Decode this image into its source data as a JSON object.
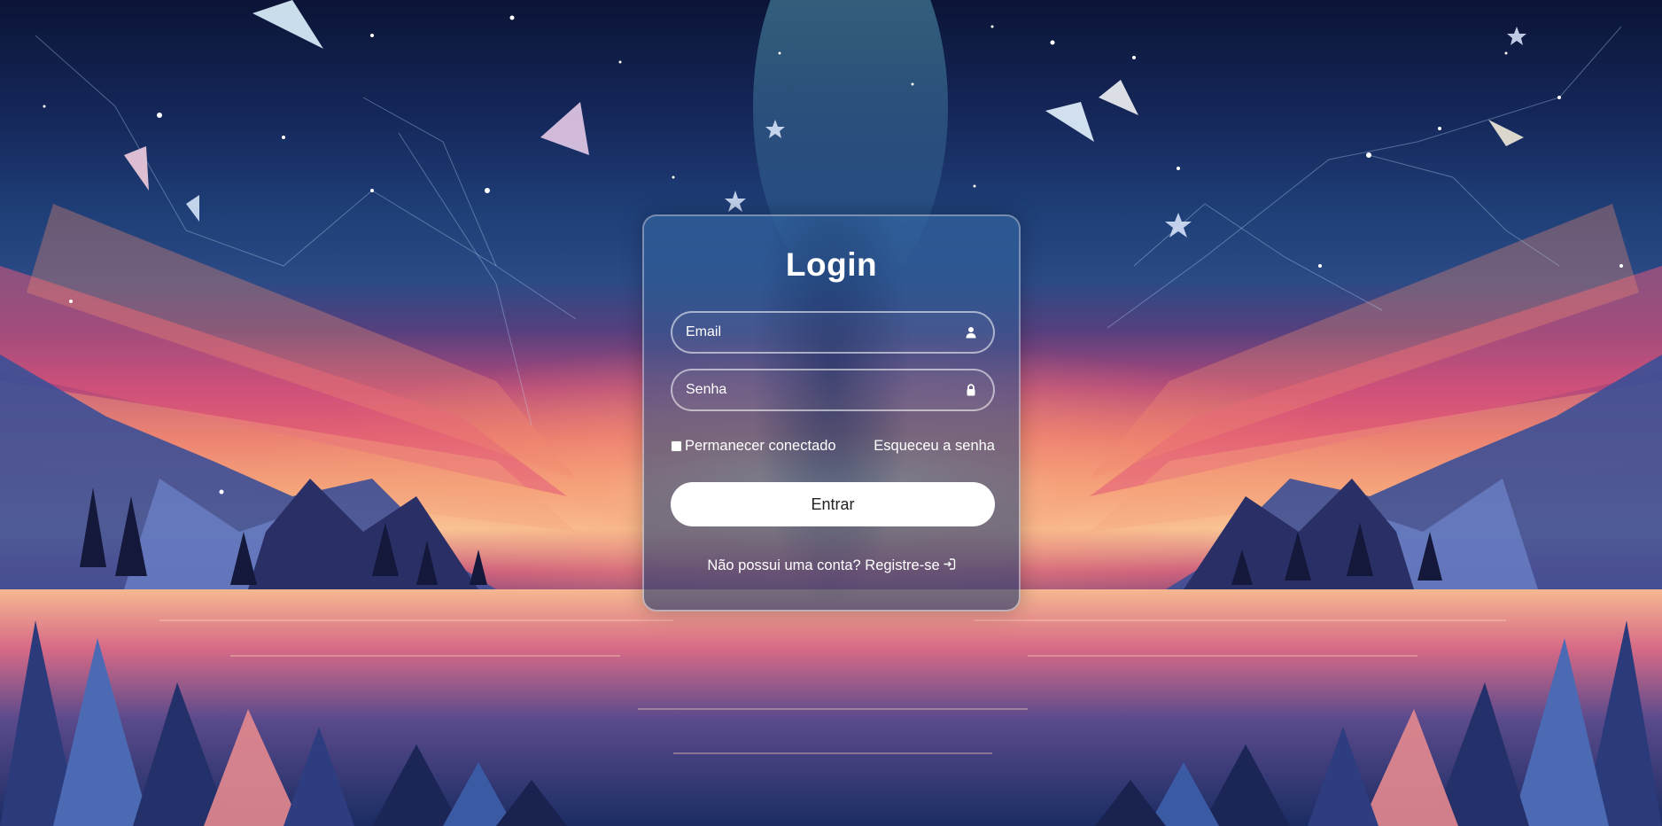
{
  "login": {
    "title": "Login",
    "email": {
      "placeholder": "Email",
      "icon": "user-icon"
    },
    "password": {
      "placeholder": "Senha",
      "icon": "lock-icon"
    },
    "remember_label": "Permanecer conectado",
    "remember_checked": false,
    "forgot_label": "Esqueceu a senha",
    "submit_label": "Entrar",
    "register_prompt": "Não possui uma conta?",
    "register_link": "Registre-se",
    "register_icon": "sign-in-icon"
  },
  "colors": {
    "button_bg": "#ffffff",
    "button_text": "#222222",
    "text": "#ffffff"
  }
}
